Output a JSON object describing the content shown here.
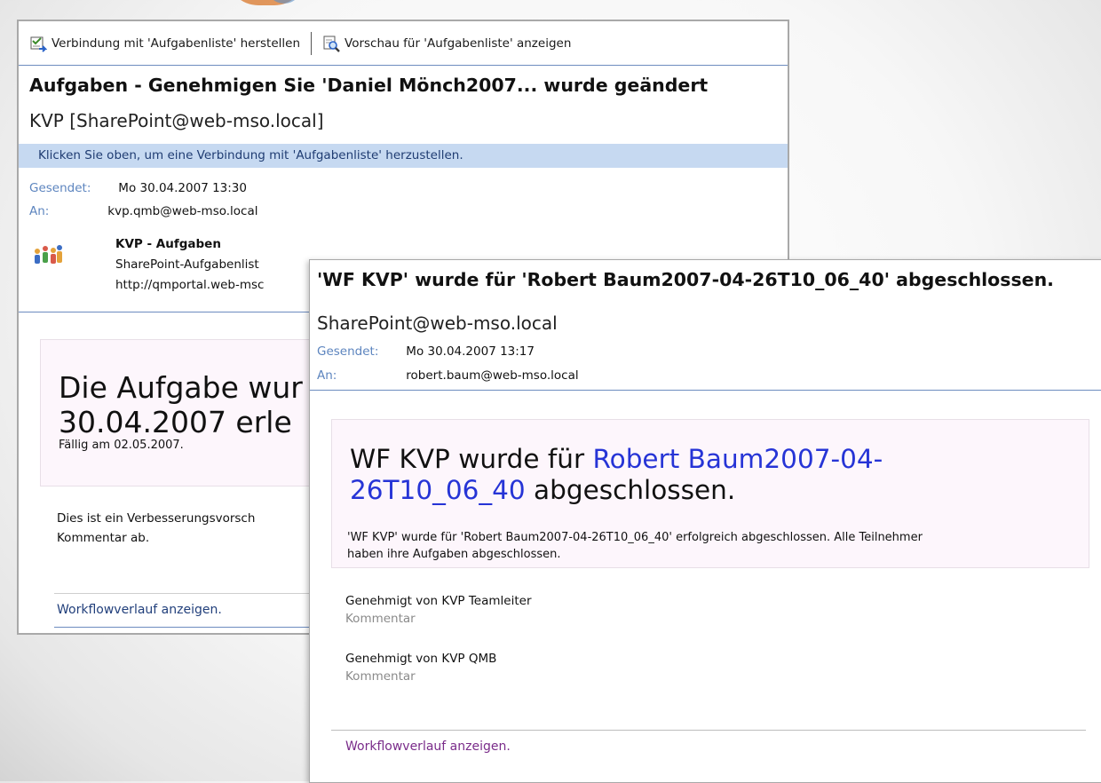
{
  "window_back": {
    "toolbar": {
      "connect_label": "Verbindung mit 'Aufgabenliste' herstellen",
      "preview_label": "Vorschau für 'Aufgabenliste' anzeigen"
    },
    "subject": "Aufgaben - Genehmigen Sie 'Daniel Mönch2007... wurde geändert",
    "from": "KVP [SharePoint@web-mso.local]",
    "infobar": "Klicken Sie oben, um eine Verbindung mit 'Aufgabenliste' herzustellen.",
    "sent_label": "Gesendet:",
    "sent_value": "Mo 30.04.2007 13:30",
    "to_label": "An:",
    "to_value": "kvp.qmb@web-mso.local",
    "attachment": {
      "title": "KVP - Aufgaben",
      "type": "SharePoint-Aufgabenlist",
      "url": "http://qmportal.web-msc"
    },
    "heading_line1": "Die Aufgabe wur",
    "heading_line2": "30.04.2007 erle",
    "due": "Fällig am 02.05.2007.",
    "body_line1": "Dies ist ein Verbesserungsvorsch",
    "body_line2": "Kommentar ab.",
    "workflow_link": "Workflowverlauf anzeigen."
  },
  "window_front": {
    "subject": "'WF KVP' wurde für 'Robert Baum2007-04-26T10_06_40' abgeschlossen.",
    "from": "SharePoint@web-mso.local",
    "sent_label": "Gesendet:",
    "sent_value": "Mo 30.04.2007 13:17",
    "to_label": "An:",
    "to_value": "robert.baum@web-mso.local",
    "heading_prefix": "WF KVP wurde für ",
    "heading_link_part1": "Robert Baum2007-04-",
    "heading_link_part2": "26T10_06_40",
    "heading_suffix": " abgeschlossen.",
    "summary_line1": "'WF KVP' wurde für 'Robert Baum2007-04-26T10_06_40' erfolgreich abgeschlossen. Alle Teilnehmer",
    "summary_line2": "haben ihre Aufgaben abgeschlossen.",
    "approvals": [
      {
        "text": "Genehmigt von KVP Teamleiter",
        "comment": "Kommentar"
      },
      {
        "text": "Genehmigt von KVP QMB",
        "comment": "Kommentar"
      }
    ],
    "workflow_link": "Workflowverlauf anzeigen."
  },
  "colors": {
    "label_blue": "#5d85bf",
    "infobar_bg": "#c6d9f1",
    "link_blue": "#2634d6",
    "visited_link": "#7a2c8a"
  }
}
